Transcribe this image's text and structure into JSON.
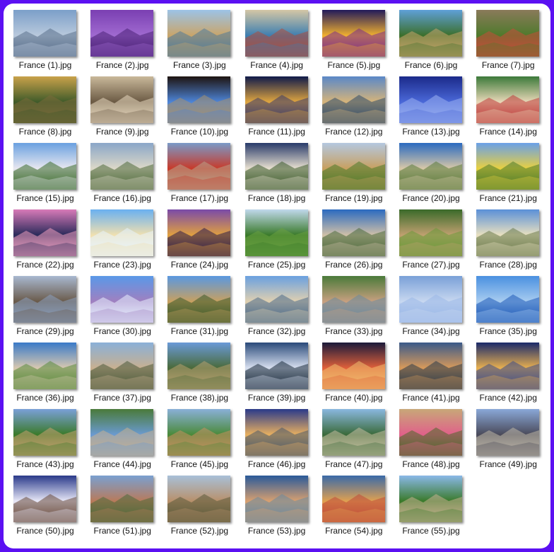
{
  "window": {
    "background": "#ffffff",
    "frame_color": "#5b10f2"
  },
  "gallery": {
    "columns": 7,
    "items": [
      {
        "label": "France (1).jpg",
        "icon": "snowy-mountain-lake-thumbnail",
        "palette": [
          "#7b9fc9",
          "#b9c9dc",
          "#5a6f8a"
        ]
      },
      {
        "label": "France (2).jpg",
        "icon": "lavender-arc-de-triomphe-thumbnail",
        "palette": [
          "#7a3fb2",
          "#a06ad0",
          "#4b2176"
        ]
      },
      {
        "label": "France (3).jpg",
        "icon": "harbor-boats-town-thumbnail",
        "palette": [
          "#9cc3e6",
          "#c9a56a",
          "#4f7a9a"
        ]
      },
      {
        "label": "France (4).jpg",
        "icon": "canal-boats-thumbnail",
        "palette": [
          "#d4c6a5",
          "#3e7fb0",
          "#b04a3a"
        ]
      },
      {
        "label": "France (5).jpg",
        "icon": "eiffel-tower-night-thumbnail",
        "palette": [
          "#221a5a",
          "#f0b030",
          "#7b2c8c"
        ]
      },
      {
        "label": "France (6).jpg",
        "icon": "cliff-river-village-thumbnail",
        "palette": [
          "#5fa0d8",
          "#3b6f2c",
          "#c9a46a"
        ]
      },
      {
        "label": "France (7).jpg",
        "icon": "stone-wall-flowers-thumbnail",
        "palette": [
          "#8a7a5a",
          "#4f7a2c",
          "#c84a3a"
        ]
      },
      {
        "label": "France (8).jpg",
        "icon": "castle-river-sunset-thumbnail",
        "palette": [
          "#c9a24a",
          "#3f5a2a",
          "#7a6a3a"
        ]
      },
      {
        "label": "France (9).jpg",
        "icon": "champs-elysees-avenue-thumbnail",
        "palette": [
          "#c9b89a",
          "#6b5a44",
          "#e8d9bf"
        ]
      },
      {
        "label": "France (10).jpg",
        "icon": "carcassonne-arch-thumbnail",
        "palette": [
          "#1e1410",
          "#4d85d8",
          "#a9926c"
        ]
      },
      {
        "label": "France (11).jpg",
        "icon": "chateau-bridge-night-thumbnail",
        "palette": [
          "#0f1a4a",
          "#e0a640",
          "#3a3a6a"
        ]
      },
      {
        "label": "France (12).jpg",
        "icon": "chambord-reflection-thumbnail",
        "palette": [
          "#5a88c8",
          "#d6b47a",
          "#2e4a6a"
        ]
      },
      {
        "label": "France (13).jpg",
        "icon": "chateau-blue-night-thumbnail",
        "palette": [
          "#1b2a8a",
          "#4a68d8",
          "#9ab0f0"
        ]
      },
      {
        "label": "France (14).jpg",
        "icon": "garden-chateau-thumbnail",
        "palette": [
          "#3c7a3a",
          "#e8d8b8",
          "#c03a3a"
        ]
      },
      {
        "label": "France (15).jpg",
        "icon": "white-chateau-towers-thumbnail",
        "palette": [
          "#6aa0e0",
          "#e8e8f0",
          "#3a6a2a"
        ]
      },
      {
        "label": "France (16).jpg",
        "icon": "chateau-garden-balustrade-thumbnail",
        "palette": [
          "#8aa6c8",
          "#dcd8c8",
          "#4f6a3a"
        ]
      },
      {
        "label": "France (17).jpg",
        "icon": "chateau-red-flowers-thumbnail",
        "palette": [
          "#7a9ac8",
          "#c83a2a",
          "#b8a48a"
        ]
      },
      {
        "label": "France (18).jpg",
        "icon": "chenonceau-river-thumbnail",
        "palette": [
          "#283a6a",
          "#e8e0d0",
          "#3a5a2a"
        ]
      },
      {
        "label": "France (19).jpg",
        "icon": "stone-chateau-vineyard-thumbnail",
        "palette": [
          "#b4c8e0",
          "#c8a060",
          "#4a7a2a"
        ]
      },
      {
        "label": "France (20).jpg",
        "icon": "coastline-bay-thumbnail",
        "palette": [
          "#2a6ac0",
          "#d8c8a8",
          "#5a7a3a"
        ]
      },
      {
        "label": "France (21).jpg",
        "icon": "yellow-fields-mountains-thumbnail",
        "palette": [
          "#6aa0e8",
          "#e8d040",
          "#4a7a2a"
        ]
      },
      {
        "label": "France (22).jpg",
        "icon": "paris-pink-sunset-thumbnail",
        "palette": [
          "#d87ab8",
          "#2a2a5a",
          "#f0a0c0"
        ]
      },
      {
        "label": "France (23).jpg",
        "icon": "fountain-eiffel-thumbnail",
        "palette": [
          "#6ab0f0",
          "#f0e0b0",
          "#e8f4ff"
        ]
      },
      {
        "label": "France (24).jpg",
        "icon": "eiffel-tower-dusk-thumbnail",
        "palette": [
          "#7a4aa8",
          "#e0a040",
          "#2a1a4a"
        ]
      },
      {
        "label": "France (25).jpg",
        "icon": "green-vineyard-thumbnail",
        "palette": [
          "#c0d8ec",
          "#3a7a2a",
          "#6aa040"
        ]
      },
      {
        "label": "France (26).jpg",
        "icon": "coastal-town-sea-thumbnail",
        "palette": [
          "#2a6ac0",
          "#d0c0a8",
          "#4a6a3a"
        ]
      },
      {
        "label": "France (27).jpg",
        "icon": "castle-forest-thumbnail",
        "palette": [
          "#3a6a2a",
          "#c0a070",
          "#6a9a3a"
        ]
      },
      {
        "label": "France (28).jpg",
        "icon": "lighthouse-cliff-thumbnail",
        "palette": [
          "#5a90d8",
          "#e8e0c0",
          "#6a7a4a"
        ]
      },
      {
        "label": "France (29).jpg",
        "icon": "mountain-lake-reflection-thumbnail",
        "palette": [
          "#a8b8d0",
          "#6a5a4a",
          "#8aa0c0"
        ]
      },
      {
        "label": "France (30).jpg",
        "icon": "lavender-field-sky-thumbnail",
        "palette": [
          "#5a98e8",
          "#a080c0",
          "#e8f0ff"
        ]
      },
      {
        "label": "France (31).jpg",
        "icon": "pont-du-gard-aqueduct-thumbnail",
        "palette": [
          "#5a98e0",
          "#c8a060",
          "#3a5a2a"
        ]
      },
      {
        "label": "France (32).jpg",
        "icon": "chateau-riverbank-thumbnail",
        "palette": [
          "#6aa0e0",
          "#e0d0b0",
          "#4a6a8a"
        ]
      },
      {
        "label": "France (33).jpg",
        "icon": "alsace-canal-houses-thumbnail",
        "palette": [
          "#4a7a3a",
          "#c8a080",
          "#6a8aa0"
        ]
      },
      {
        "label": "France (34).jpg",
        "icon": "mont-saint-michel-mist-thumbnail",
        "palette": [
          "#7aa0d8",
          "#c8d8f0",
          "#9ab8e8"
        ]
      },
      {
        "label": "France (35).jpg",
        "icon": "mont-saint-michel-blue-thumbnail",
        "palette": [
          "#4a90e0",
          "#a8ccf0",
          "#1e5ab8"
        ]
      },
      {
        "label": "France (36).jpg",
        "icon": "harbor-marina-thumbnail",
        "palette": [
          "#3a7ac8",
          "#d8c8b0",
          "#5a8a3a"
        ]
      },
      {
        "label": "France (37).jpg",
        "icon": "bridge-town-river-thumbnail",
        "palette": [
          "#8ab0d8",
          "#c8b090",
          "#4a5a3a"
        ]
      },
      {
        "label": "France (38).jpg",
        "icon": "river-bridge-towers-thumbnail",
        "palette": [
          "#6a9ad8",
          "#4a6a3a",
          "#b8a070"
        ]
      },
      {
        "label": "France (39).jpg",
        "icon": "alps-lake-reflection-thumbnail",
        "palette": [
          "#2a4a7a",
          "#d8e0f0",
          "#1a2a3a"
        ]
      },
      {
        "label": "France (40).jpg",
        "icon": "night-market-square-thumbnail",
        "palette": [
          "#1a1a3a",
          "#e0603a",
          "#f0c070"
        ]
      },
      {
        "label": "France (41).jpg",
        "icon": "rocky-coast-sunset-thumbnail",
        "palette": [
          "#3a5a8a",
          "#d89a5a",
          "#2a3a4a"
        ]
      },
      {
        "label": "France (42).jpg",
        "icon": "louvre-pyramid-night-thumbnail",
        "palette": [
          "#1a2a6a",
          "#e8b050",
          "#3a4a8a"
        ]
      },
      {
        "label": "France (43).jpg",
        "icon": "village-vineyard-hills-thumbnail",
        "palette": [
          "#7aa0d8",
          "#3a7a2a",
          "#c8a070"
        ]
      },
      {
        "label": "France (44).jpg",
        "icon": "river-valley-town-thumbnail",
        "palette": [
          "#4a7a3a",
          "#6a9ad0",
          "#c8b090"
        ]
      },
      {
        "label": "France (45).jpg",
        "icon": "hillside-vineyard-village-thumbnail",
        "palette": [
          "#8ab0d8",
          "#4a8a3a",
          "#c89060"
        ]
      },
      {
        "label": "France (46).jpg",
        "icon": "coastal-town-evening-thumbnail",
        "palette": [
          "#2a3a8a",
          "#e8b060",
          "#4a5a6a"
        ]
      },
      {
        "label": "France (47).jpg",
        "icon": "bridge-waterfall-thumbnail",
        "palette": [
          "#8ab8e0",
          "#3a6a3a",
          "#c8c0a0"
        ]
      },
      {
        "label": "France (48).jpg",
        "icon": "cloister-flowers-thumbnail",
        "palette": [
          "#c8a878",
          "#e0608a",
          "#4a6a2a"
        ]
      },
      {
        "label": "France (49).jpg",
        "icon": "notre-dame-seine-thumbnail",
        "palette": [
          "#8aa8d8",
          "#4a4a5a",
          "#c0b8a8"
        ]
      },
      {
        "label": "France (50).jpg",
        "icon": "snowy-village-night-thumbnail",
        "palette": [
          "#2a3a8a",
          "#e8e8f8",
          "#6a4a3a"
        ]
      },
      {
        "label": "France (51).jpg",
        "icon": "mountain-village-roofs-thumbnail",
        "palette": [
          "#7aa0d0",
          "#b87a5a",
          "#4a6a3a"
        ]
      },
      {
        "label": "France (52).jpg",
        "icon": "hilltop-village-thumbnail",
        "palette": [
          "#a8c0d8",
          "#b8906a",
          "#5a5a3a"
        ]
      },
      {
        "label": "France (53).jpg",
        "icon": "harbor-aerial-thumbnail",
        "palette": [
          "#2a5a9a",
          "#d8a070",
          "#6a8aa0"
        ]
      },
      {
        "label": "France (54).jpg",
        "icon": "colorful-harbor-houses-thumbnail",
        "palette": [
          "#3a6aa8",
          "#e0a050",
          "#c04a3a"
        ]
      },
      {
        "label": "France (55).jpg",
        "icon": "vineyard-chateau-thumbnail",
        "palette": [
          "#8ab8e8",
          "#3a7a2a",
          "#c8b090"
        ]
      }
    ]
  }
}
